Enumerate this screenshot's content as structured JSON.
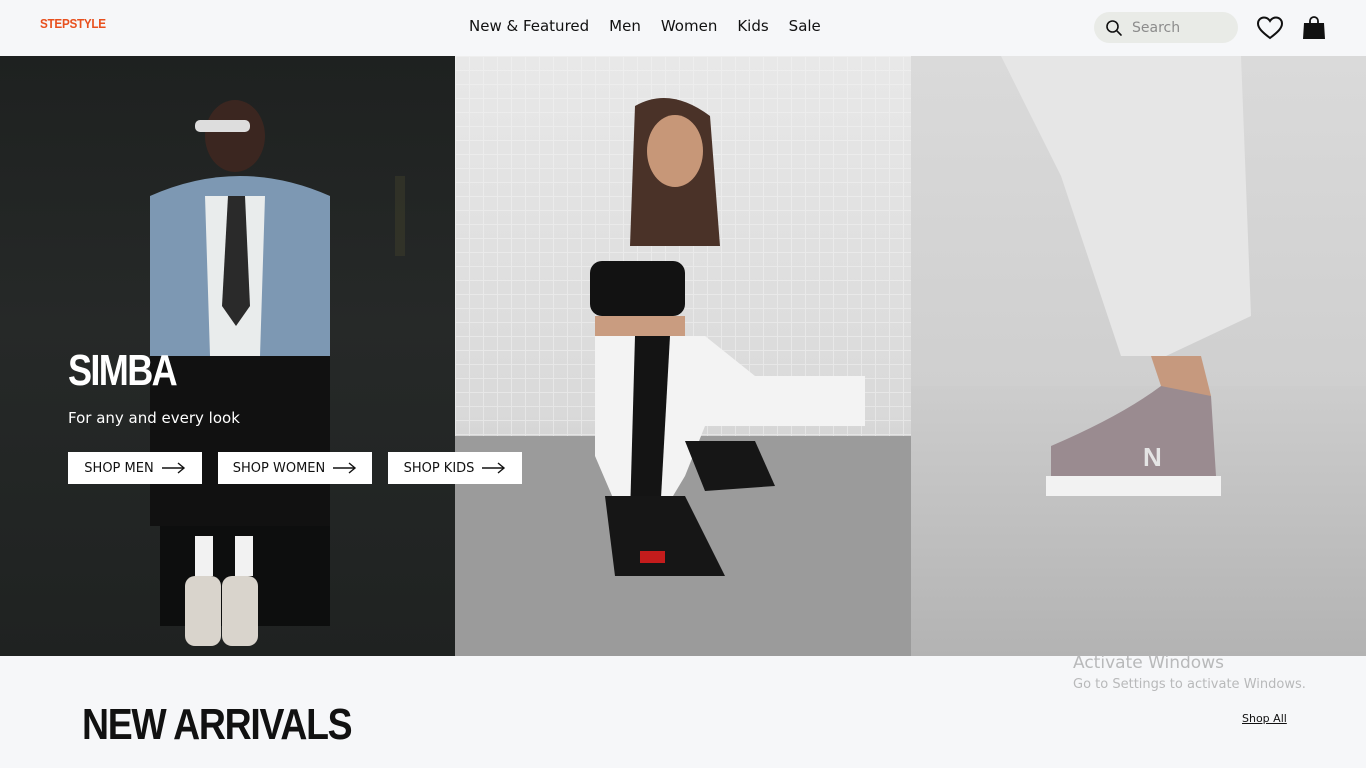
{
  "header": {
    "logo": "STEPSTYLE",
    "nav": [
      "New & Featured",
      "Men",
      "Women",
      "Kids",
      "Sale"
    ],
    "search_placeholder": "Search",
    "icons": {
      "search": "search-icon",
      "wishlist": "heart-icon",
      "cart": "shopping-bag-icon"
    }
  },
  "hero": {
    "title": "SIMBA",
    "subtitle": "For any and every look",
    "buttons": [
      "SHOP MEN",
      "SHOP WOMEN",
      "SHOP KIDS"
    ],
    "button_icon": "arrow-right-icon"
  },
  "arrivals": {
    "heading": "NEW ARRIVALS",
    "shop_all": "Shop All"
  },
  "watermark": {
    "title": "Activate Windows",
    "subtitle": "Go to Settings to activate Windows."
  },
  "colors": {
    "brand": "#e8501e",
    "background": "#f6f7f9",
    "search_bg": "#e9ebe7"
  }
}
